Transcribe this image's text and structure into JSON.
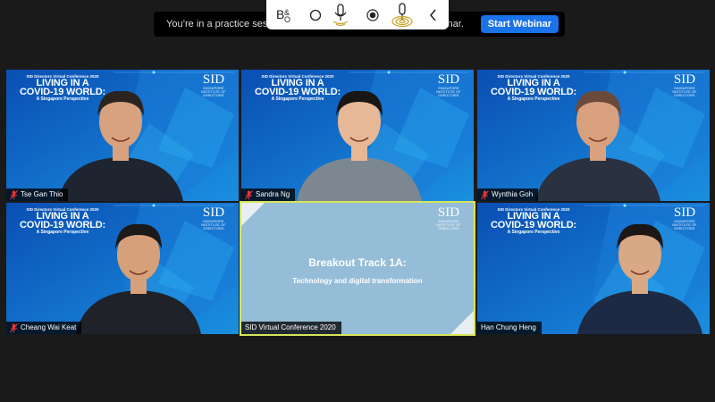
{
  "banner": {
    "text_left": "You’re in a practice sessi",
    "text_right": "binar.",
    "start_label": "Start Webinar"
  },
  "toolbar": {
    "icons": [
      "bo-logo-icon",
      "circle-icon",
      "microphone-icon",
      "record-icon",
      "podcast-icon",
      "chevron-left-icon"
    ]
  },
  "conference_branding": {
    "small": "SID Directors Virtual Conference 2020",
    "big_line1": "LIVING IN A",
    "big_line2": "COVID-19 WORLD:",
    "sub": "A Singapore Perspective",
    "logo": "SID",
    "logo_sub": "SINGAPORE INSTITUTE OF DIRECTORS"
  },
  "participants": [
    {
      "name": "Tse Gan Thio",
      "muted": true
    },
    {
      "name": "Sandra Ng",
      "muted": true
    },
    {
      "name": "Wynthia Goh",
      "muted": true
    },
    {
      "name": "Cheang Wai Keat",
      "muted": true
    },
    {
      "name": "SID Virtual Conference 2020",
      "muted": false
    },
    {
      "name": "Han Chung Heng",
      "muted": false
    }
  ],
  "slide": {
    "title": "Breakout Track 1A:",
    "subtitle": "Technology and digital transformation"
  },
  "colors": {
    "background": "#1a1a1a",
    "tile_blue": "#0e5fc2",
    "slide_blue": "#95bdd8",
    "active_speaker_border": "#d8e45a",
    "start_button": "#1a73e8"
  }
}
